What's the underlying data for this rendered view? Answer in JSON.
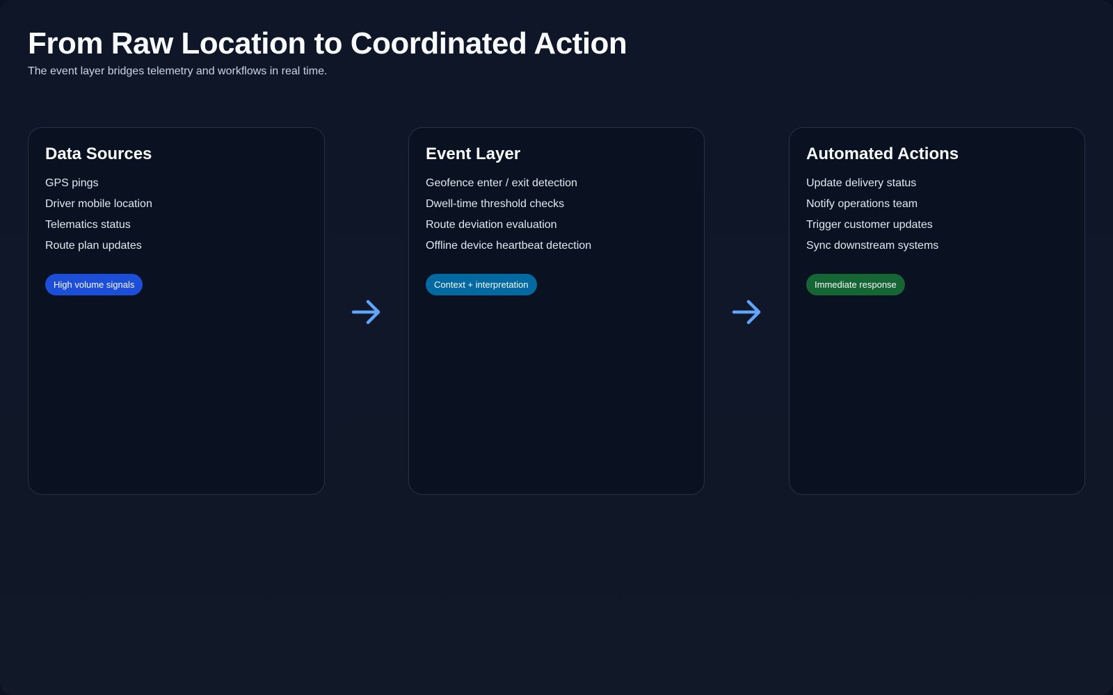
{
  "header": {
    "title": "From Raw Location to Coordinated Action",
    "subtitle": "The event layer bridges telemetry and workflows in real time."
  },
  "stages": [
    {
      "title": "Data Sources",
      "items": [
        "GPS pings",
        "Driver mobile location",
        "Telematics status",
        "Route plan updates"
      ],
      "badge": "High volume signals",
      "badge_color": "#1d4ed8"
    },
    {
      "title": "Event Layer",
      "items": [
        "Geofence enter / exit detection",
        "Dwell-time threshold checks",
        "Route deviation evaluation",
        "Offline device heartbeat detection"
      ],
      "badge": "Context + interpretation",
      "badge_color": "#0369a1"
    },
    {
      "title": "Automated Actions",
      "items": [
        "Update delivery status",
        "Notify operations team",
        "Trigger customer updates",
        "Sync downstream systems"
      ],
      "badge": "Immediate response",
      "badge_color": "#166534"
    }
  ],
  "connectors": [
    {
      "icon": "arrow-right-icon",
      "color": "#60a5fa"
    },
    {
      "icon": "arrow-right-icon",
      "color": "#60a5fa"
    }
  ]
}
